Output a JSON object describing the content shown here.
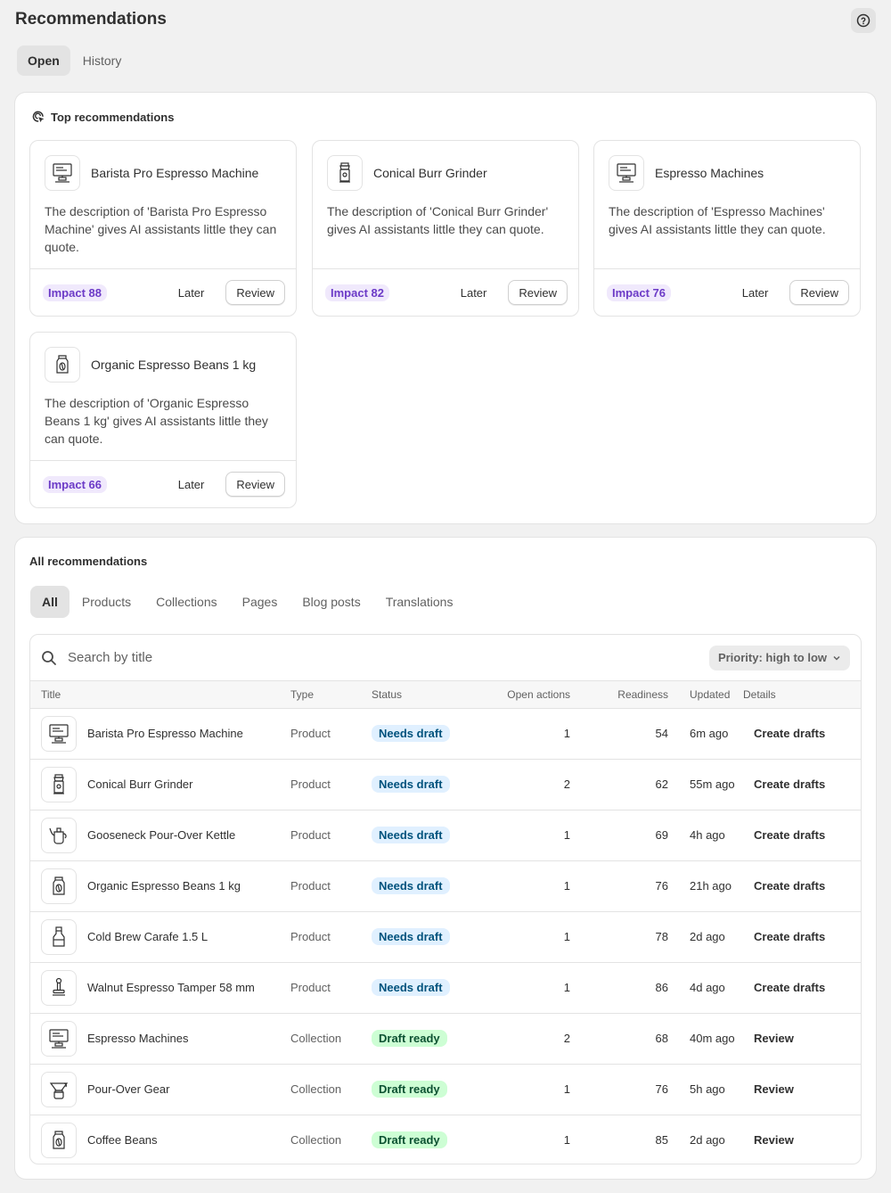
{
  "page": {
    "title": "Recommendations"
  },
  "top_tabs": [
    {
      "label": "Open",
      "active": true
    },
    {
      "label": "History",
      "active": false
    }
  ],
  "top_recommendations": {
    "title": "Top recommendations",
    "items": [
      {
        "title": "Barista Pro Espresso Machine",
        "icon": "espresso-machine-icon",
        "description": "The description of 'Barista Pro Espresso Machine' gives AI assistants little they can quote.",
        "impact": "Impact 88",
        "later": "Later",
        "review": "Review"
      },
      {
        "title": "Conical Burr Grinder",
        "icon": "grinder-icon",
        "description": "The description of 'Conical Burr Grinder' gives AI assistants little they can quote.",
        "impact": "Impact 82",
        "later": "Later",
        "review": "Review"
      },
      {
        "title": "Espresso Machines",
        "icon": "espresso-machine-icon",
        "description": "The description of 'Espresso Machines' gives AI assistants little they can quote.",
        "impact": "Impact 76",
        "later": "Later",
        "review": "Review"
      },
      {
        "title": "Organic Espresso Beans 1 kg",
        "icon": "coffee-bag-icon",
        "description": "The description of 'Organic Espresso Beans 1 kg' gives AI assistants little they can quote.",
        "impact": "Impact 66",
        "later": "Later",
        "review": "Review"
      }
    ]
  },
  "all_recommendations": {
    "title": "All recommendations",
    "filters": [
      {
        "label": "All",
        "active": true
      },
      {
        "label": "Products",
        "active": false
      },
      {
        "label": "Collections",
        "active": false
      },
      {
        "label": "Pages",
        "active": false
      },
      {
        "label": "Blog posts",
        "active": false
      },
      {
        "label": "Translations",
        "active": false
      }
    ],
    "search": {
      "placeholder": "Search by title"
    },
    "sort": {
      "label": "Priority: high to low"
    },
    "columns": {
      "title": "Title",
      "type": "Type",
      "status": "Status",
      "open_actions": "Open actions",
      "readiness": "Readiness",
      "updated": "Updated",
      "details": "Details"
    },
    "rows": [
      {
        "title": "Barista Pro Espresso Machine",
        "icon": "espresso-machine-icon",
        "type": "Product",
        "status": "Needs draft",
        "open_actions": "1",
        "readiness": "54",
        "updated": "6m ago",
        "details": "Create drafts"
      },
      {
        "title": "Conical Burr Grinder",
        "icon": "grinder-icon",
        "type": "Product",
        "status": "Needs draft",
        "open_actions": "2",
        "readiness": "62",
        "updated": "55m ago",
        "details": "Create drafts"
      },
      {
        "title": "Gooseneck Pour-Over Kettle",
        "icon": "kettle-icon",
        "type": "Product",
        "status": "Needs draft",
        "open_actions": "1",
        "readiness": "69",
        "updated": "4h ago",
        "details": "Create drafts"
      },
      {
        "title": "Organic Espresso Beans 1 kg",
        "icon": "coffee-bag-icon",
        "type": "Product",
        "status": "Needs draft",
        "open_actions": "1",
        "readiness": "76",
        "updated": "21h ago",
        "details": "Create drafts"
      },
      {
        "title": "Cold Brew Carafe 1.5 L",
        "icon": "carafe-icon",
        "type": "Product",
        "status": "Needs draft",
        "open_actions": "1",
        "readiness": "78",
        "updated": "2d ago",
        "details": "Create drafts"
      },
      {
        "title": "Walnut Espresso Tamper 58 mm",
        "icon": "tamper-icon",
        "type": "Product",
        "status": "Needs draft",
        "open_actions": "1",
        "readiness": "86",
        "updated": "4d ago",
        "details": "Create drafts"
      },
      {
        "title": "Espresso Machines",
        "icon": "espresso-machine-icon",
        "type": "Collection",
        "status": "Draft ready",
        "open_actions": "2",
        "readiness": "68",
        "updated": "40m ago",
        "details": "Review"
      },
      {
        "title": "Pour-Over Gear",
        "icon": "pour-over-icon",
        "type": "Collection",
        "status": "Draft ready",
        "open_actions": "1",
        "readiness": "76",
        "updated": "5h ago",
        "details": "Review"
      },
      {
        "title": "Coffee Beans",
        "icon": "coffee-bag-icon",
        "type": "Collection",
        "status": "Draft ready",
        "open_actions": "1",
        "readiness": "85",
        "updated": "2d ago",
        "details": "Review"
      }
    ]
  },
  "colors": {
    "impact_bg": "#f0e9fc",
    "impact_text": "#6c3bc7",
    "needs_draft_bg": "#e0f0ff",
    "draft_ready_bg": "#cdfed4"
  }
}
